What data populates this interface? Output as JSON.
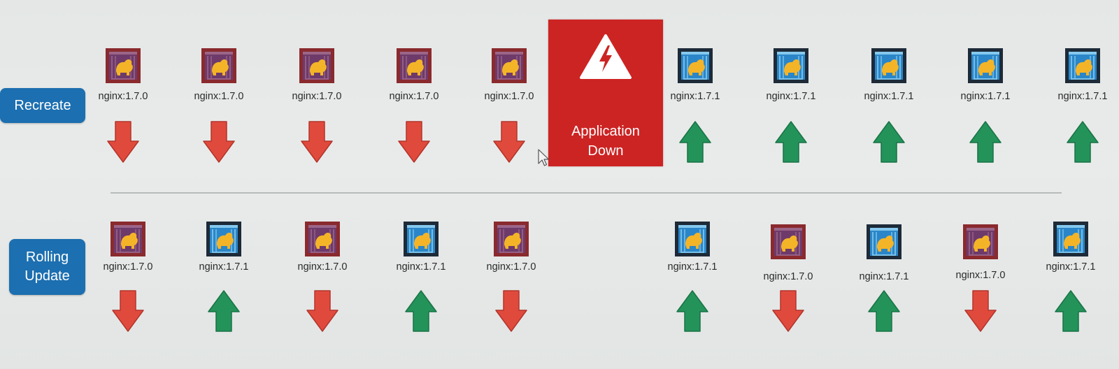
{
  "strategies": {
    "recreate": {
      "label": "Recreate"
    },
    "rolling": {
      "label_line1": "Rolling",
      "label_line2": "Update"
    }
  },
  "recreate_row": {
    "pods": [
      {
        "label": "nginx:1.7.0",
        "version": "old",
        "action": "down"
      },
      {
        "label": "nginx:1.7.0",
        "version": "old",
        "action": "down"
      },
      {
        "label": "nginx:1.7.0",
        "version": "old",
        "action": "down"
      },
      {
        "label": "nginx:1.7.0",
        "version": "old",
        "action": "down"
      },
      {
        "label": "nginx:1.7.0",
        "version": "old",
        "action": "down"
      },
      {
        "label": "nginx:1.7.1",
        "version": "new",
        "action": "up"
      },
      {
        "label": "nginx:1.7.1",
        "version": "new",
        "action": "up"
      },
      {
        "label": "nginx:1.7.1",
        "version": "new",
        "action": "up"
      },
      {
        "label": "nginx:1.7.1",
        "version": "new",
        "action": "up"
      },
      {
        "label": "nginx:1.7.1",
        "version": "new",
        "action": "up"
      }
    ]
  },
  "application_down": {
    "line1": "Application",
    "line2": "Down",
    "icon": "high-voltage-warning-icon"
  },
  "rolling_row": {
    "pods": [
      {
        "label": "nginx:1.7.0",
        "version": "old",
        "action": "down"
      },
      {
        "label": "nginx:1.7.1",
        "version": "new",
        "action": "up"
      },
      {
        "label": "nginx:1.7.0",
        "version": "old",
        "action": "down"
      },
      {
        "label": "nginx:1.7.1",
        "version": "new",
        "action": "up"
      },
      {
        "label": "nginx:1.7.0",
        "version": "old",
        "action": "down"
      },
      {
        "label": "nginx:1.7.1",
        "version": "new",
        "action": "up"
      },
      {
        "label": "nginx:1.7.0",
        "version": "old",
        "action": "down"
      },
      {
        "label": "nginx:1.7.1",
        "version": "new",
        "action": "up"
      },
      {
        "label": "nginx:1.7.0",
        "version": "old",
        "action": "down"
      },
      {
        "label": "nginx:1.7.1",
        "version": "new",
        "action": "up"
      }
    ]
  },
  "colors": {
    "button_blue": "#1c6fb0",
    "down_arrow_red": "#e04a3d",
    "up_arrow_green": "#23935a",
    "old_container_frame": "#8a2a2e",
    "old_container_fill": "#6e3a6a",
    "new_container_frame": "#1d2a38",
    "new_container_fill": "#2a86c8",
    "container_logo_yellow": "#f4b428",
    "application_down_red": "#cc2423"
  },
  "icons": {
    "old_container": "nginx-1-7-0-container-icon",
    "new_container": "nginx-1-7-1-container-icon",
    "remove": "arrow-down-icon",
    "add": "arrow-up-icon",
    "cursor": "mouse-pointer-icon"
  }
}
